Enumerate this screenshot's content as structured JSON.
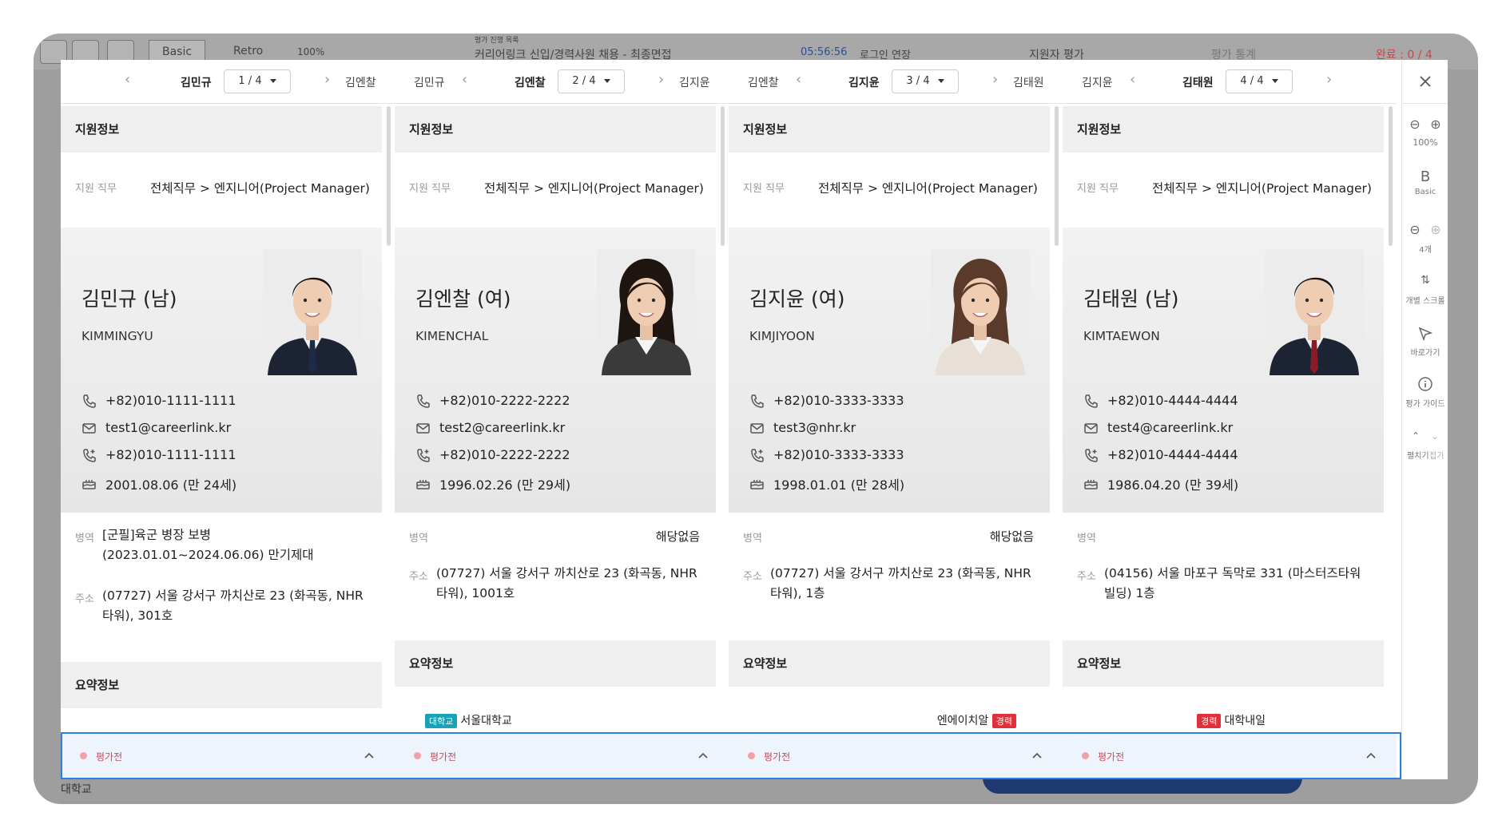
{
  "background": {
    "topbar": {
      "view_basic": "Basic",
      "view_retro": "Retro",
      "zoom": "100%",
      "project_caption": "평가 진행 목록",
      "project": "커리어링크 신입/경력사원 채용 - 최종면접",
      "timer": "05:56:56",
      "extend": "로그인 연장",
      "tab_eval": "지원자 평가",
      "tab_stats": "평가 통계",
      "done": "완료 : 0 / 4"
    },
    "bottom_label": "대학교"
  },
  "columns": [
    {
      "nav": {
        "prev": "",
        "current": "김민규",
        "select": "1 / 4",
        "next": "김엔찰"
      },
      "section_apply": "지원정보",
      "job_label": "지원 직무",
      "job": "전체직무 > 엔지니어(Project Manager)",
      "name": "김민규 (남)",
      "eng": "KIMMINGYU",
      "phone": "+82)010-1111-1111",
      "email": "test1@careerlink.kr",
      "phone2": "+82)010-1111-1111",
      "birth": "2001.08.06 (만 24세)",
      "military_label": "병역",
      "military": "[군필]육군 병장 보병 (2023.01.01~2024.06.06) 만기제대",
      "military_right": "",
      "address_label": "주소",
      "address": "(07727) 서울 강서구 까치산로 23 (화곡동, NHR 타워), 301호",
      "section_summary": "요약정보",
      "summary_badge": "",
      "summary_text": "",
      "status": "평가전",
      "photo": "man1"
    },
    {
      "nav": {
        "prev": "김민규",
        "current": "김엔찰",
        "select": "2 / 4",
        "next": "김지윤"
      },
      "section_apply": "지원정보",
      "job_label": "지원 직무",
      "job": "전체직무 > 엔지니어(Project Manager)",
      "name": "김엔찰 (여)",
      "eng": "KIMENCHAL",
      "phone": "+82)010-2222-2222",
      "email": "test2@careerlink.kr",
      "phone2": "+82)010-2222-2222",
      "birth": "1996.02.26 (만 29세)",
      "military_label": "병역",
      "military": "",
      "military_right": "해당없음",
      "address_label": "주소",
      "address": "(07727) 서울 강서구 까치산로 23 (화곡동, NHR 타워), 1001호",
      "section_summary": "요약정보",
      "summary_badge": "대학교",
      "summary_text": "서울대학교",
      "status": "평가전",
      "photo": "woman1"
    },
    {
      "nav": {
        "prev": "김엔찰",
        "current": "김지윤",
        "select": "3 / 4",
        "next": "김태원"
      },
      "section_apply": "지원정보",
      "job_label": "지원 직무",
      "job": "전체직무 > 엔지니어(Project Manager)",
      "name": "김지윤 (여)",
      "eng": "KIMJIYOON",
      "phone": "+82)010-3333-3333",
      "email": "test3@nhr.kr",
      "phone2": "+82)010-3333-3333",
      "birth": "1998.01.01 (만 28세)",
      "military_label": "병역",
      "military": "",
      "military_right": "해당없음",
      "address_label": "주소",
      "address": "(07727) 서울 강서구 까치산로 23 (화곡동, NHR 타워), 1층",
      "section_summary": "요약정보",
      "summary_badge": "경력",
      "summary_text": "엔에이치알",
      "status": "평가전",
      "photo": "woman2"
    },
    {
      "nav": {
        "prev": "김지윤",
        "current": "김태원",
        "select": "4 / 4",
        "next": ""
      },
      "section_apply": "지원정보",
      "job_label": "지원 직무",
      "job": "전체직무 > 엔지니어(Project Manager)",
      "name": "김태원 (남)",
      "eng": "KIMTAEWON",
      "phone": "+82)010-4444-4444",
      "email": "test4@careerlink.kr",
      "phone2": "+82)010-4444-4444",
      "birth": "1986.04.20 (만 39세)",
      "military_label": "병역",
      "military": "",
      "military_right": "",
      "address_label": "주소",
      "address": "(04156) 서울 마포구 독막로 331 (마스터즈타워 빌딩) 1층",
      "section_summary": "요약정보",
      "summary_badge": "경력",
      "summary_text": "대학내일",
      "status": "평가전",
      "photo": "man2"
    }
  ],
  "toolbar": {
    "zoom": "100%",
    "view": "Basic",
    "count": "4개",
    "scroll": "개별 스크롤",
    "goto": "바로가기",
    "guide": "평가 가이드",
    "expand": "펼치기",
    "collapse": "접기"
  },
  "colors": {
    "accent": "#2f7de1",
    "status": "#d24a5a",
    "badge_school": "#17a2b8",
    "badge_career": "#e0303c"
  }
}
